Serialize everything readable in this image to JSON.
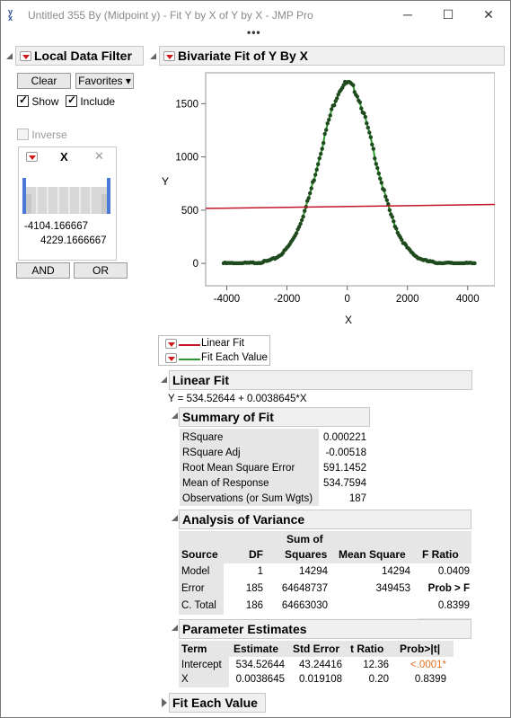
{
  "window": {
    "title": "Untitled 355 By (Midpoint y) - Fit Y by X of Y by X - JMP Pro",
    "minimize": "─",
    "maximize": "☐",
    "close": "✕",
    "overflow": "•••"
  },
  "filter": {
    "title": "Local Data Filter",
    "clear": "Clear",
    "favorites": "Favorites ▾",
    "show": "Show",
    "include": "Include",
    "inverse": "Inverse",
    "column": "X",
    "min": "-4104.166667",
    "max": "4229.1666667",
    "and": "AND",
    "or": "OR"
  },
  "bivariate": {
    "title": "Bivariate Fit of Y By X",
    "ylabel": "Y",
    "xlabel": "X"
  },
  "chart_data": {
    "type": "scatter",
    "xlim": [
      -4700,
      4900
    ],
    "ylim": [
      -210,
      1790
    ],
    "xticks": [
      -4000,
      -2000,
      0,
      2000,
      4000
    ],
    "xtick_labels": [
      "-4000",
      "-2000",
      "0",
      "2000",
      "4000"
    ],
    "yticks": [
      0,
      500,
      1000,
      1500
    ],
    "ytick_labels": [
      "0",
      "500",
      "1000",
      "1500"
    ],
    "xlabel": "X",
    "ylabel": "Y",
    "points_model": "gaussian bell",
    "peak": 1690,
    "sigma": 900,
    "x_range": [
      -4104.166667,
      4229.1666667
    ],
    "n_points": 187,
    "linear_fit": {
      "intercept": 534.52644,
      "slope": 0.0038645,
      "color": "#c4162a"
    },
    "each_value_color": "#2a9a2a",
    "point_color": "#1e4a1e"
  },
  "legend": {
    "linear_fit": "Linear Fit",
    "fit_each_value": "Fit Each Value",
    "linear_color": "#c4162a",
    "each_color": "#2a9a2a"
  },
  "linear_fit": {
    "title": "Linear Fit",
    "equation": "Y = 534.52644 + 0.0038645*X"
  },
  "summary": {
    "title": "Summary of Fit",
    "rows": [
      {
        "label": "RSquare",
        "value": "0.000221"
      },
      {
        "label": "RSquare Adj",
        "value": "-0.00518"
      },
      {
        "label": "Root Mean Square Error",
        "value": "591.1452"
      },
      {
        "label": "Mean of Response",
        "value": "534.7594"
      },
      {
        "label": "Observations (or Sum Wgts)",
        "value": "187"
      }
    ]
  },
  "anova": {
    "title": "Analysis of Variance",
    "headers": [
      "Source",
      "DF",
      "Sum of",
      "Squares",
      "Mean Square",
      "F Ratio"
    ],
    "rows": [
      {
        "source": "Model",
        "df": "1",
        "ss": "14294",
        "ms": "14294",
        "f": "0.0409"
      },
      {
        "source": "Error",
        "df": "185",
        "ss": "64648737",
        "ms": "349453",
        "f": "Prob > F"
      },
      {
        "source": "C. Total",
        "df": "186",
        "ss": "64663030",
        "ms": "",
        "f": "0.8399"
      }
    ]
  },
  "params": {
    "title": "Parameter Estimates",
    "headers": [
      "Term",
      "Estimate",
      "Std Error",
      "t Ratio",
      "Prob>|t|"
    ],
    "rows": [
      {
        "term": "Intercept",
        "estimate": "534.52644",
        "se": "43.24416",
        "t": "12.36",
        "p": "<.0001*"
      },
      {
        "term": "X",
        "estimate": "0.0038645",
        "se": "0.019108",
        "t": "0.20",
        "p": "0.8399"
      }
    ],
    "sig_color": "#e07020"
  },
  "fit_each": {
    "title": "Fit Each Value"
  }
}
